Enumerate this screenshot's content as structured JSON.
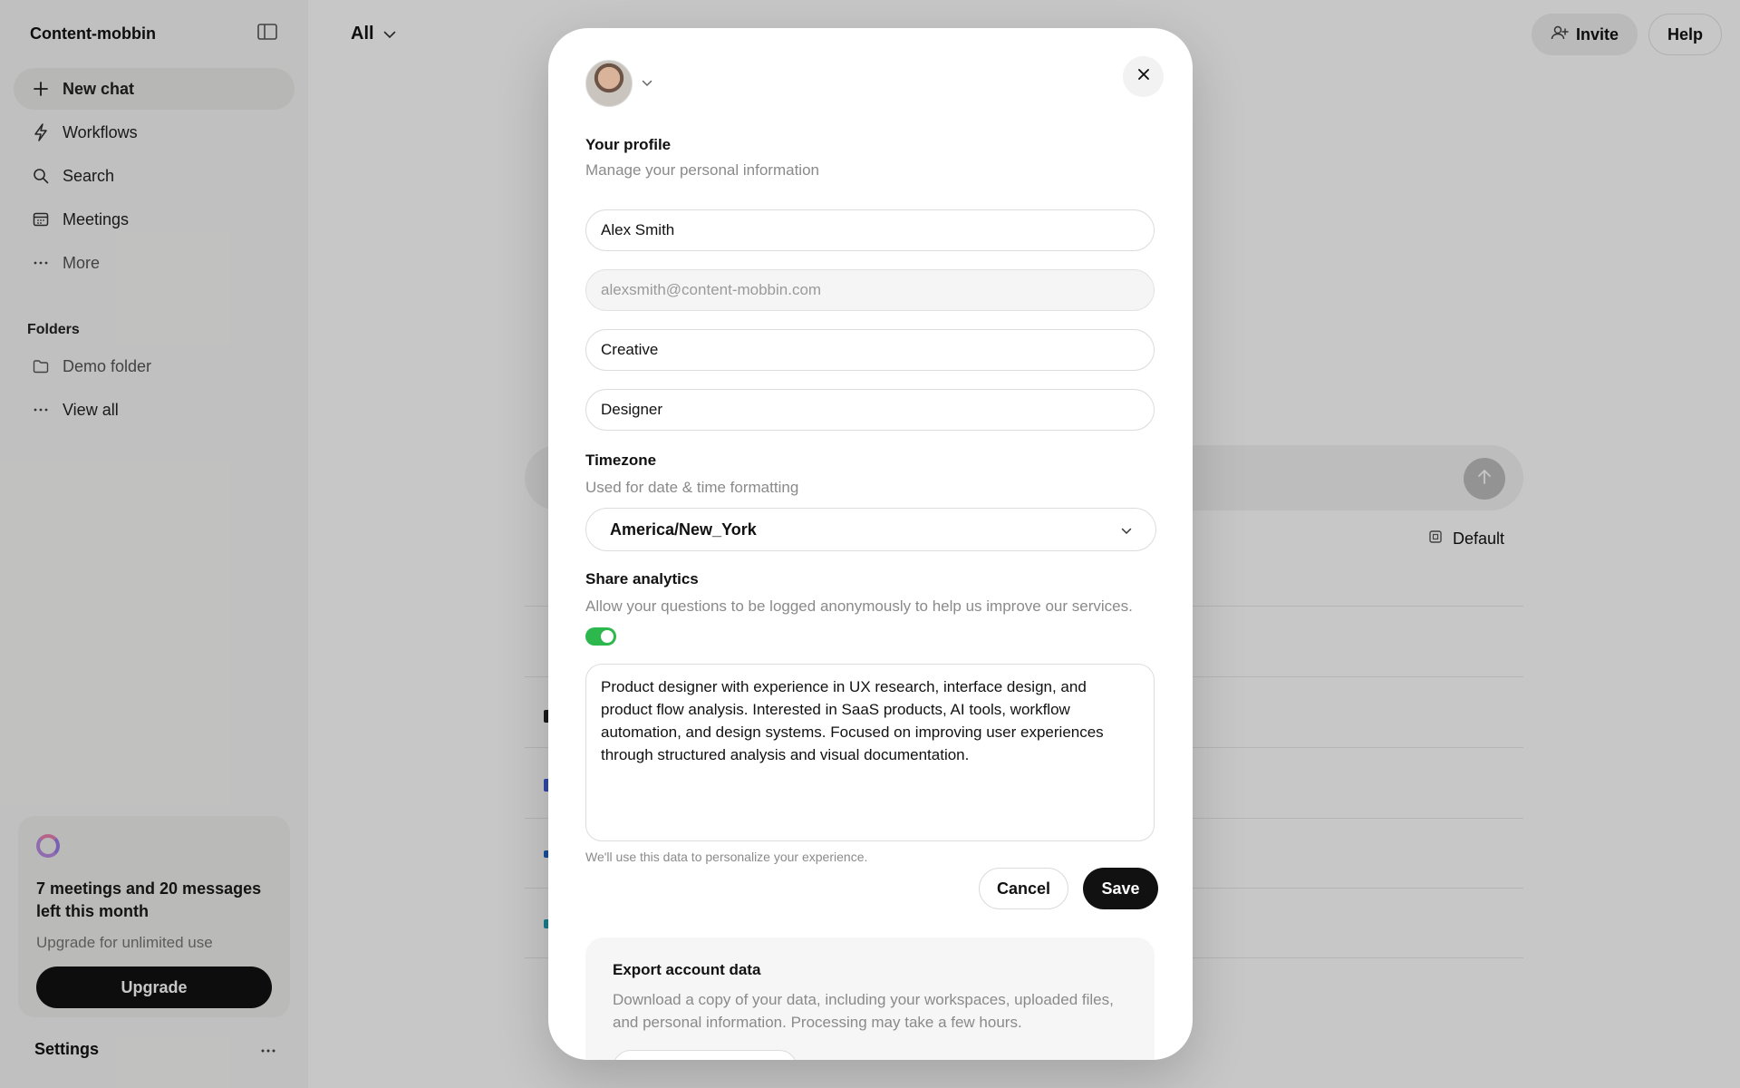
{
  "sidebar": {
    "workspace_name": "Content-mobbin",
    "nav": [
      {
        "label": "New chat",
        "icon": "plus-icon"
      },
      {
        "label": "Workflows",
        "icon": "bolt-icon"
      },
      {
        "label": "Search",
        "icon": "search-icon"
      },
      {
        "label": "Meetings",
        "icon": "calendar-icon"
      },
      {
        "label": "More",
        "icon": "more-icon"
      }
    ],
    "folders_heading": "Folders",
    "folders": [
      {
        "label": "Demo folder",
        "icon": "folder-icon"
      },
      {
        "label": "View all",
        "icon": "more-icon"
      }
    ],
    "upsell": {
      "title": "7 meetings and 20 messages left this month",
      "subtitle": "Upgrade for unlimited use",
      "button": "Upgrade"
    },
    "settings_label": "Settings"
  },
  "main": {
    "scope_label": "All",
    "invite_label": "Invite",
    "help_label": "Help",
    "model_label": "Default"
  },
  "profile_modal": {
    "section_title": "Your profile",
    "section_subtitle": "Manage your personal information",
    "fields": {
      "name": "Alex Smith",
      "email": "alexsmith@content-mobbin.com",
      "department": "Creative",
      "role": "Designer"
    },
    "timezone": {
      "title": "Timezone",
      "subtitle": "Used for date & time formatting",
      "value": "America/New_York"
    },
    "analytics": {
      "title": "Share analytics",
      "subtitle": "Allow your questions to be logged anonymously to help us improve our services.",
      "enabled": true
    },
    "bio": "Product designer with experience in UX research, interface design, and product flow analysis. Interested in SaaS products, AI tools, workflow automation, and design systems. Focused on improving user experiences through structured analysis and visual documentation.",
    "bio_hint": "We'll use this data to personalize your experience.",
    "cancel_label": "Cancel",
    "save_label": "Save",
    "export": {
      "title": "Export account data",
      "subtitle": "Download a copy of your data, including your workspaces, uploaded files, and personal information. Processing may take a few hours."
    }
  },
  "colors": {
    "accent": "#111111",
    "toggle_on": "#2db84d"
  }
}
